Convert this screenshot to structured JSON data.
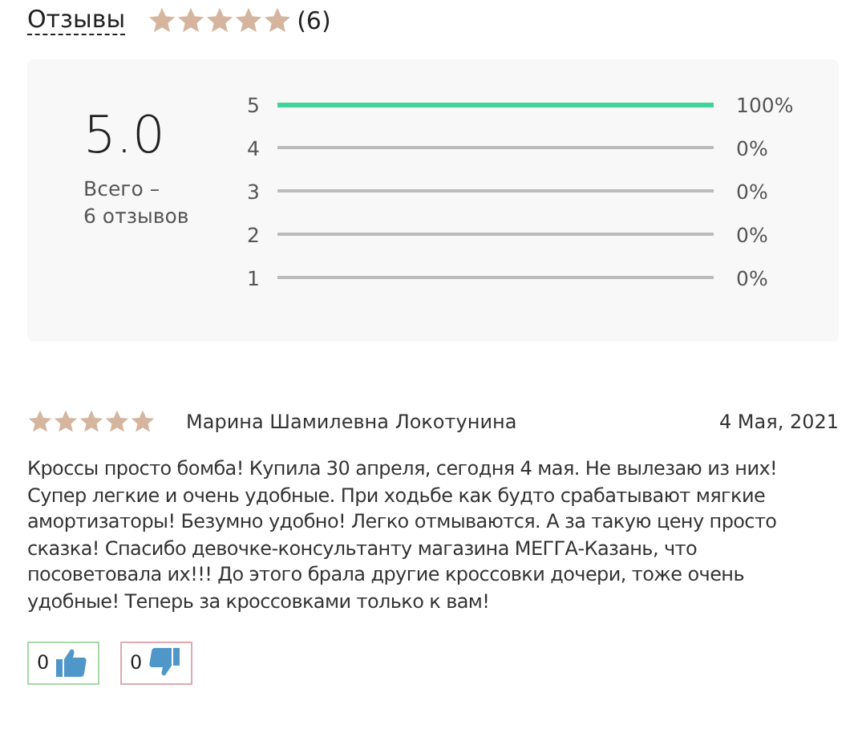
{
  "header": {
    "title": "Отзывы",
    "stars": 5,
    "count": "(6)"
  },
  "summary": {
    "score": "5.0",
    "total": "Всего –\n6 отзывов",
    "rows": [
      {
        "label": "5",
        "level": 1,
        "percent": "100%"
      },
      {
        "label": "4",
        "level": 0,
        "percent": "0%"
      },
      {
        "label": "3",
        "level": 0,
        "percent": "0%"
      },
      {
        "label": "2",
        "level": 0,
        "percent": "0%"
      },
      {
        "label": "1",
        "level": 0,
        "percent": "0%"
      }
    ]
  },
  "reviews": [
    {
      "stars": 5,
      "author": "Марина Шамилевна Локотунина",
      "date": "4 Мая, 2021",
      "text": "Кроссы просто бомба! Купила 30 апреля, сегодня 4 мая. Не вылезаю из них! Супер легкие и очень удобные. При ходьбе как будто срабатывают мягкие амортизаторы! Безумно удобно! Легко отмываются. А за такую цену просто сказка! Спасибо девочке-консультанту магазина МЕГГА-Казань, что посоветовала их!!! До этого брала другие кроссовки дочери, тоже очень удобные! Теперь за кроссовками только к вам!",
      "likes": "0",
      "dislikes": "0"
    }
  ]
}
